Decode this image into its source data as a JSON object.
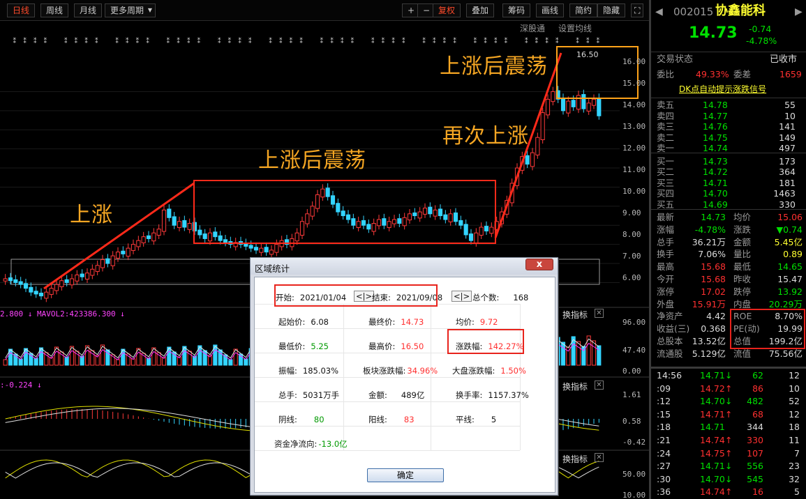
{
  "toolbar": {
    "periods": [
      "日线",
      "周线",
      "月线",
      "更多周期"
    ],
    "right_buttons": [
      "+",
      "−",
      "复权",
      "叠加",
      "筹码",
      "画线",
      "简约",
      "隐藏"
    ],
    "sub_left": "深股通",
    "sub_right": "设置均线"
  },
  "axis_main": [
    "16.00",
    "15.00",
    "14.00",
    "13.00",
    "12.00",
    "11.00",
    "10.00",
    "9.00",
    "8.00",
    "7.00",
    "6.00"
  ],
  "axis_vol": [
    "96.00",
    "47.40",
    "0.00"
  ],
  "axis_macd": [
    "1.61",
    "0.58",
    "-0.42"
  ],
  "axis_kdj": [
    "50.00",
    "10.00"
  ],
  "peak_label": "16.50",
  "indicators": {
    "vol": "2.800 ↓ MAVOL2:423386.300 ↓",
    "macd": ":-0.224 ↓",
    "tab_label": "换指标"
  },
  "annotations": {
    "rise": "上涨",
    "consolidate1": "上涨后震荡",
    "rise_again": "再次上涨",
    "consolidate2": "上涨后震荡"
  },
  "dialog": {
    "title": "区域统计",
    "close": "x",
    "start_label": "开始:",
    "start_value": "2021/01/04",
    "end_label": "结束:",
    "end_value": "2021/09/08",
    "total_label": "总个数:",
    "total_value": "168",
    "open_label": "起始价:",
    "open_value": "6.08",
    "final_label": "最终价:",
    "final_value": "14.73",
    "avg_label": "均价:",
    "avg_value": "9.72",
    "low_label": "最低价:",
    "low_value": "5.25",
    "high_label": "最高价:",
    "high_value": "16.50",
    "chg_label": "涨跌幅:",
    "chg_value": "142.27%",
    "amp_label": "振幅:",
    "amp_value": "185.03%",
    "sector_label": "板块涨跌幅:",
    "sector_value": "34.96%",
    "market_label": "大盘涨跌幅:",
    "market_value": "1.50%",
    "hands_label": "总手:",
    "hands_value": "5031万手",
    "amount_label": "金额:",
    "amount_value": "489亿",
    "turn_label": "换手率:",
    "turn_value": "1157.37%",
    "yin_label": "阴线:",
    "yin_value": "80",
    "yang_label": "阳线:",
    "yang_value": "83",
    "flat_label": "平线:",
    "flat_value": "5",
    "flow_label": "资金净流向:",
    "flow_value": "-13.0亿",
    "ok": "确定"
  },
  "stock": {
    "code": "002015",
    "name": "协鑫能科",
    "price": "14.73",
    "chg": "-0.74",
    "pct": "-4.78%",
    "status_label": "交易状态",
    "status_value": "已收市",
    "wb_label": "委比",
    "wb_value": "49.33%",
    "wc_label": "委差",
    "wc_value": "1659",
    "dk_link": "DK点自动提示涨跌信号"
  },
  "orderbook": {
    "sells": [
      {
        "label": "卖五",
        "price": "14.78",
        "vol": "55"
      },
      {
        "label": "卖四",
        "price": "14.77",
        "vol": "10"
      },
      {
        "label": "卖三",
        "price": "14.76",
        "vol": "141"
      },
      {
        "label": "卖二",
        "price": "14.75",
        "vol": "149"
      },
      {
        "label": "卖一",
        "price": "14.74",
        "vol": "497"
      }
    ],
    "buys": [
      {
        "label": "买一",
        "price": "14.73",
        "vol": "173"
      },
      {
        "label": "买二",
        "price": "14.72",
        "vol": "364"
      },
      {
        "label": "买三",
        "price": "14.71",
        "vol": "181"
      },
      {
        "label": "买四",
        "price": "14.70",
        "vol": "1463"
      },
      {
        "label": "买五",
        "price": "14.69",
        "vol": "330"
      }
    ]
  },
  "quote": [
    {
      "l1": "最新",
      "v1": "14.73",
      "c1": "g",
      "l2": "均价",
      "v2": "15.06",
      "c2": "r"
    },
    {
      "l1": "涨幅",
      "v1": "-4.78%",
      "c1": "g",
      "l2": "涨跌",
      "v2": "▼0.74",
      "c2": "g"
    },
    {
      "l1": "总手",
      "v1": "36.21万",
      "c1": "w",
      "l2": "金额",
      "v2": "5.45亿",
      "c2": "y"
    },
    {
      "l1": "换手",
      "v1": "7.06%",
      "c1": "w",
      "l2": "量比",
      "v2": "0.89",
      "c2": "y"
    },
    {
      "l1": "最高",
      "v1": "15.68",
      "c1": "r",
      "l2": "最低",
      "v2": "14.65",
      "c2": "g"
    },
    {
      "l1": "今开",
      "v1": "15.68",
      "c1": "r",
      "l2": "昨收",
      "v2": "15.47",
      "c2": "w"
    },
    {
      "l1": "涨停",
      "v1": "17.02",
      "c1": "r",
      "l2": "跌停",
      "v2": "13.92",
      "c2": "g"
    },
    {
      "l1": "外盘",
      "v1": "15.91万",
      "c1": "r",
      "l2": "内盘",
      "v2": "20.29万",
      "c2": "g"
    },
    {
      "l1": "净资产",
      "v1": "4.42",
      "c1": "w",
      "l2": "ROE",
      "v2": "8.70%",
      "c2": "w"
    },
    {
      "l1": "收益(三)",
      "v1": "0.368",
      "c1": "w",
      "l2": "PE(动)",
      "v2": "19.99",
      "c2": "w"
    },
    {
      "l1": "总股本",
      "v1": "13.52亿",
      "c1": "w",
      "l2": "总值",
      "v2": "199.2亿",
      "c2": "w"
    },
    {
      "l1": "流通股",
      "v1": "5.129亿",
      "c1": "w",
      "l2": "流值",
      "v2": "75.56亿",
      "c2": "w"
    }
  ],
  "ticks": [
    {
      "t": "14:56",
      "p": "14.71",
      "a": "↓",
      "ac": "g",
      "v": "62",
      "n": "12"
    },
    {
      "t": ":09",
      "p": "14.72",
      "a": "↑",
      "ac": "r",
      "v": "86",
      "n": "10"
    },
    {
      "t": ":12",
      "p": "14.70",
      "a": "↓",
      "ac": "g",
      "v": "482",
      "n": "52"
    },
    {
      "t": ":15",
      "p": "14.71",
      "a": "↑",
      "ac": "r",
      "v": "68",
      "n": "12"
    },
    {
      "t": ":18",
      "p": "14.71",
      "a": "",
      "ac": "w",
      "v": "344",
      "n": "18"
    },
    {
      "t": ":21",
      "p": "14.74",
      "a": "↑",
      "ac": "r",
      "v": "330",
      "n": "11"
    },
    {
      "t": ":24",
      "p": "14.75",
      "a": "↑",
      "ac": "r",
      "v": "107",
      "n": "7"
    },
    {
      "t": ":27",
      "p": "14.71",
      "a": "↓",
      "ac": "g",
      "v": "556",
      "n": "23"
    },
    {
      "t": ":30",
      "p": "14.70",
      "a": "↓",
      "ac": "g",
      "v": "545",
      "n": "32"
    },
    {
      "t": ":36",
      "p": "14.74",
      "a": "↑",
      "ac": "r",
      "v": "16",
      "n": "5"
    }
  ],
  "chart_data": {
    "type": "candlestick",
    "period": "日线",
    "price_range": [
      5.25,
      16.5
    ],
    "closes": [
      6.2,
      6.1,
      6.0,
      5.9,
      5.7,
      5.5,
      5.4,
      5.3,
      5.5,
      5.7,
      5.9,
      6.1,
      6.0,
      6.2,
      6.4,
      6.3,
      6.5,
      6.7,
      6.9,
      7.2,
      7.0,
      7.4,
      7.6,
      7.5,
      7.8,
      8.0,
      8.2,
      8.4,
      8.3,
      8.6,
      8.8,
      9.8,
      9.4,
      9.0,
      9.2,
      8.9,
      9.1,
      8.7,
      8.5,
      8.3,
      8.6,
      8.4,
      8.2,
      8.1,
      8.0,
      8.1,
      8.0,
      7.9,
      7.8,
      7.7,
      7.8,
      7.6,
      7.7,
      8.0,
      8.2,
      8.0,
      8.3,
      8.6,
      9.2,
      9.6,
      10.0,
      10.6,
      10.9,
      10.5,
      10.1,
      9.7,
      9.5,
      9.3,
      9.0,
      9.2,
      9.0,
      8.8,
      9.1,
      9.3,
      9.0,
      9.2,
      9.3,
      9.1,
      9.4,
      9.6,
      9.5,
      9.7,
      9.9,
      9.6,
      9.8,
      9.5,
      9.3,
      9.6,
      9.2,
      9.0,
      8.5,
      8.2,
      8.6,
      8.9,
      8.7,
      8.9,
      9.2,
      9.7,
      10.3,
      11.2,
      12.0,
      12.6,
      12.2,
      12.8,
      13.6,
      14.9,
      15.6,
      16.0,
      15.6,
      15.0,
      15.5,
      15.2,
      15.8,
      15.1,
      15.4,
      15.6,
      14.73
    ]
  }
}
